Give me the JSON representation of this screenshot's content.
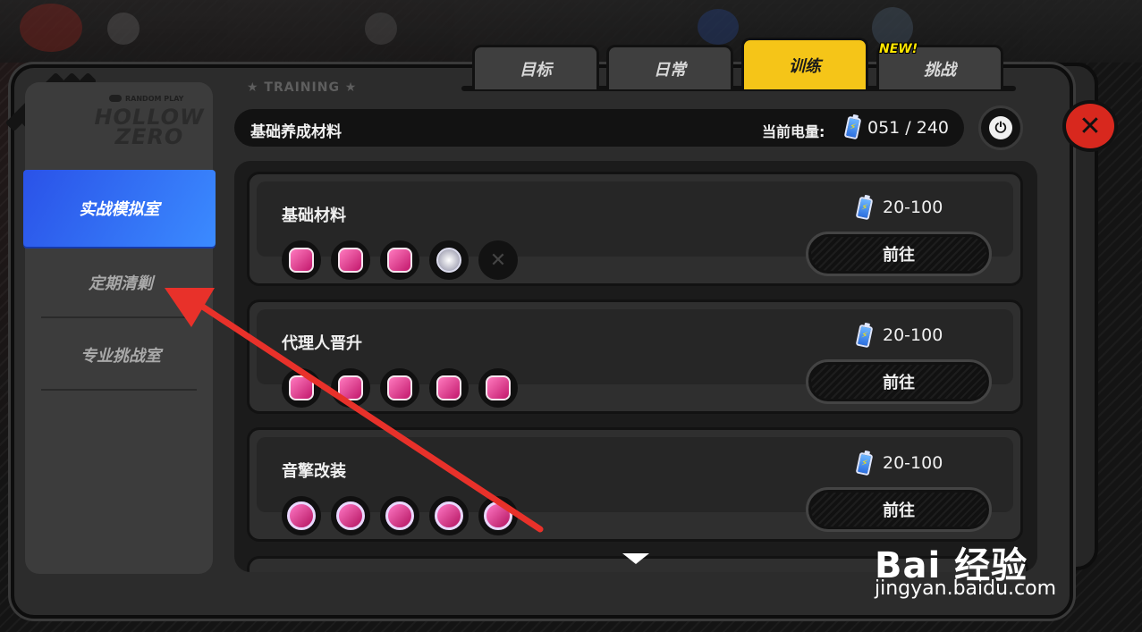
{
  "tabs": [
    {
      "label": "目标",
      "active": false
    },
    {
      "label": "日常",
      "active": false
    },
    {
      "label": "训练",
      "active": true
    },
    {
      "label": "挑战",
      "active": false
    }
  ],
  "new_badge": "NEW!",
  "section_label": "★ TRAINING ★",
  "sidebar": {
    "logo_badge": "RANDOM PLAY",
    "logo_text": "HOLLOW ZERO",
    "items": [
      {
        "label": "实战模拟室",
        "active": true
      },
      {
        "label": "定期清剿",
        "active": false
      },
      {
        "label": "专业挑战室",
        "active": false
      }
    ]
  },
  "header": {
    "title": "基础养成材料",
    "energy_label": "当前电量:",
    "energy_value": "051 / 240"
  },
  "cards": [
    {
      "title": "基础材料",
      "cost": "20-100",
      "button": "前往",
      "materials": [
        "pink-material-icon",
        "pink-material-icon",
        "pink-material-icon",
        "silver-coin-icon",
        "empty-slot-icon"
      ]
    },
    {
      "title": "代理人晋升",
      "cost": "20-100",
      "button": "前往",
      "materials": [
        "pink-material-icon",
        "pink-material-icon",
        "pink-material-icon",
        "pink-material-icon",
        "pink-material-icon"
      ]
    },
    {
      "title": "音擎改装",
      "cost": "20-100",
      "button": "前往",
      "materials": [
        "pink-material-icon",
        "pink-material-icon",
        "pink-material-icon",
        "pink-material-icon",
        "pink-material-icon"
      ]
    }
  ],
  "watermark": {
    "main": "Bai 经验",
    "sub": "jingyan.baidu.com"
  },
  "colors": {
    "active_tab": "#f5c518",
    "active_sidebar": "#2a52e8",
    "close_button": "#d8281e",
    "annotation_arrow": "#e8312a",
    "new_badge": "#ffe600"
  }
}
